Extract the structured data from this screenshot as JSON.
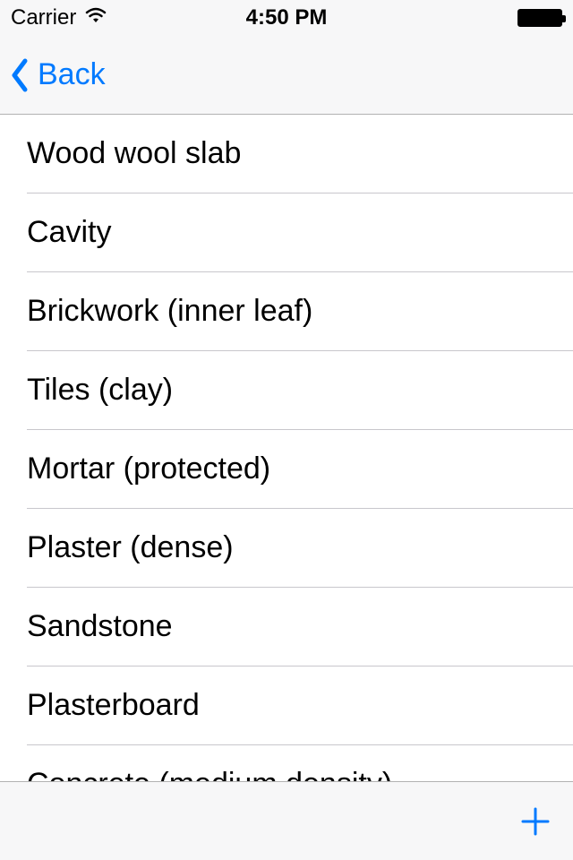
{
  "status": {
    "carrier": "Carrier",
    "time": "4:50 PM"
  },
  "nav": {
    "back_label": "Back"
  },
  "list": {
    "items": [
      "Wood wool slab",
      "Cavity",
      "Brickwork (inner leaf)",
      "Tiles (clay)",
      "Mortar (protected)",
      "Plaster (dense)",
      "Sandstone",
      "Plasterboard",
      "Concrete (medium density)"
    ]
  },
  "colors": {
    "accent": "#007aff",
    "separator": "#c8c7cc",
    "bar_bg": "#f7f7f8"
  }
}
